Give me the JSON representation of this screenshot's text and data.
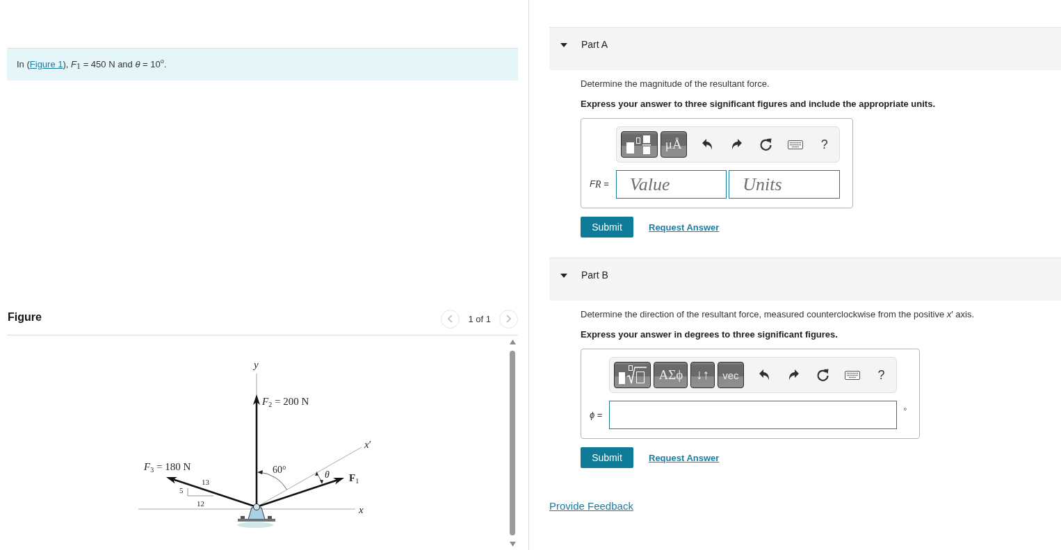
{
  "problem": {
    "lead": "In (",
    "link": "Figure 1",
    "rest": "), *F*$_{1}$ = 450 N and *θ* = 10$^{o}$."
  },
  "figure": {
    "title": "Figure",
    "pager": "1 of 1",
    "diagram": {
      "y_axis": "y",
      "f2": "*F*$_{2}$ = 200 N",
      "f3": "*F*$_{3}$ = 180 N",
      "slope_hyp": "13",
      "slope_rise": "5",
      "slope_run": "12",
      "angle": "60°",
      "theta": "θ",
      "f1": "**F**$_{1}$",
      "x_prime_axis": "*x*′",
      "x_axis": "x"
    }
  },
  "parts": [
    {
      "title": "Part A",
      "expanded": true,
      "prompt": "Determine the magnitude of the resultant force.",
      "instruction": "Express your answer to three significant figures and include the appropriate units.",
      "answer": {
        "keys": [
          {
            "kind": "fraction_templates"
          },
          {
            "kind": "symbol",
            "label": "μÅ"
          }
        ],
        "help": "?",
        "label": "*F*$_{R}$ =",
        "kind": "value_units",
        "placeholders": [
          "Value",
          "Units"
        ]
      },
      "submit": "Submit",
      "request": "Request Answer"
    },
    {
      "title": "Part B",
      "expanded": true,
      "prompt": "Determine the direction of the resultant force, measured counterclockwise from the positive *x*′ axis.",
      "instruction": "Express your answer in degrees to three significant figures.",
      "answer": {
        "keys": [
          {
            "kind": "radical_templates"
          },
          {
            "kind": "symbol",
            "label": "ΑΣϕ"
          },
          {
            "kind": "symbol",
            "label": "↓↑"
          },
          {
            "kind": "text",
            "label": "vec"
          }
        ],
        "help": "?",
        "label": "*ϕ* =",
        "kind": "number",
        "suffix": "°"
      },
      "submit": "Submit",
      "request": "Request Answer"
    }
  ],
  "feedback": "Provide Feedback"
}
